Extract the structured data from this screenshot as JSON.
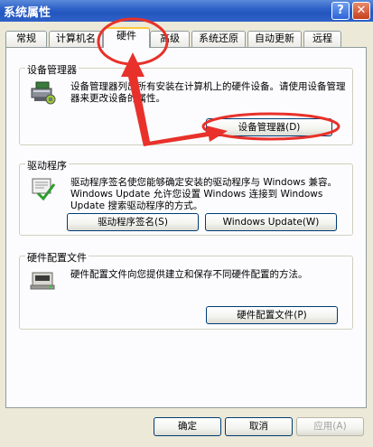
{
  "window": {
    "title": "系统属性",
    "help_glyph": "?",
    "close_glyph": "✕"
  },
  "tabs": [
    {
      "label": "常规"
    },
    {
      "label": "计算机名"
    },
    {
      "label": "硬件",
      "active": true
    },
    {
      "label": "高级"
    },
    {
      "label": "系统还原"
    },
    {
      "label": "自动更新"
    },
    {
      "label": "远程"
    }
  ],
  "device_manager": {
    "title": "设备管理器",
    "description": "设备管理器列出所有安装在计算机上的硬件设备。请使用设备管理器来更改设备的属性。",
    "button_label": "设备管理器(D)"
  },
  "drivers": {
    "title": "驱动程序",
    "description": "驱动程序签名使您能够确定安装的驱动程序与 Windows 兼容。Windows Update 允许您设置 Windows 连接到 Windows Update 搜索驱动程序的方式。",
    "signing_button_label": "驱动程序签名(S)",
    "update_button_label": "Windows Update(W)"
  },
  "hardware_profiles": {
    "title": "硬件配置文件",
    "description": "硬件配置文件向您提供建立和保存不同硬件配置的方法。",
    "button_label": "硬件配置文件(P)"
  },
  "footer": {
    "ok_label": "确定",
    "cancel_label": "取消",
    "apply_label": "应用(A)"
  },
  "colors": {
    "annotation": "#e8312a",
    "title_bar": "#2456bd",
    "panel": "#fcfcfe",
    "dialog": "#ece9d8"
  }
}
